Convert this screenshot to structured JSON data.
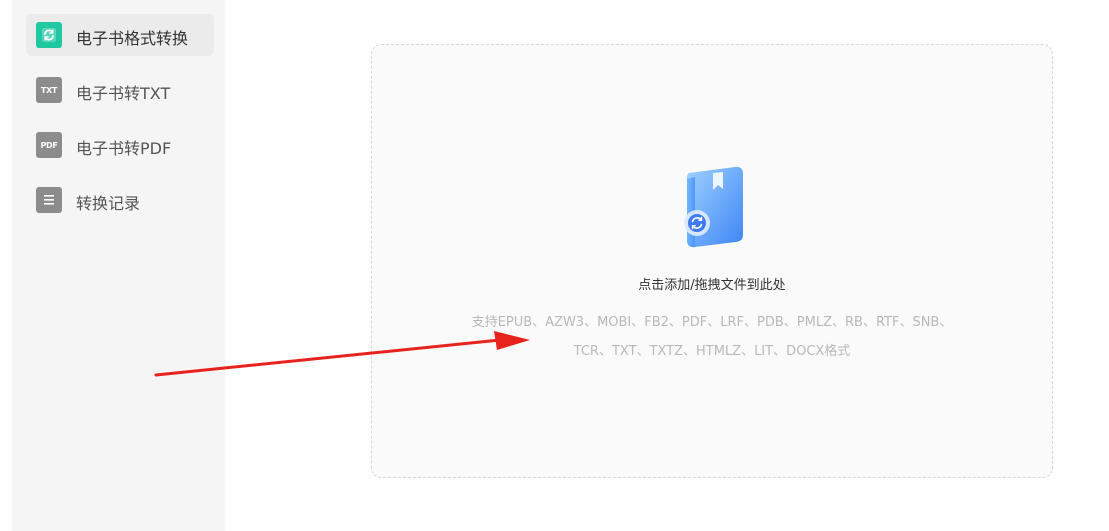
{
  "sidebar": {
    "items": [
      {
        "label": "电子书格式转换",
        "icon": "refresh-book-icon",
        "active": true
      },
      {
        "label": "电子书转TXT",
        "icon": "txt-file-icon",
        "badge": "TXT",
        "active": false
      },
      {
        "label": "电子书转PDF",
        "icon": "pdf-file-icon",
        "badge": "PDF",
        "active": false
      },
      {
        "label": "转换记录",
        "icon": "document-list-icon",
        "active": false
      }
    ]
  },
  "dropzone": {
    "prompt": "点击添加/拖拽文件到此处",
    "formats_line1": "支持EPUB、AZW3、MOBI、FB2、PDF、LRF、PDB、PMLZ、RB、RTF、SNB、",
    "formats_line2": "TCR、TXT、TXTZ、HTMLZ、LIT、DOCX格式",
    "icon": "book-convert-icon"
  },
  "annotation": {
    "icon": "red-arrow",
    "color": "#e8221c"
  },
  "colors": {
    "accent": "#1fc8a0",
    "sidebar_bg": "#f5f5f5",
    "icon_gray": "#8c8c8c"
  }
}
